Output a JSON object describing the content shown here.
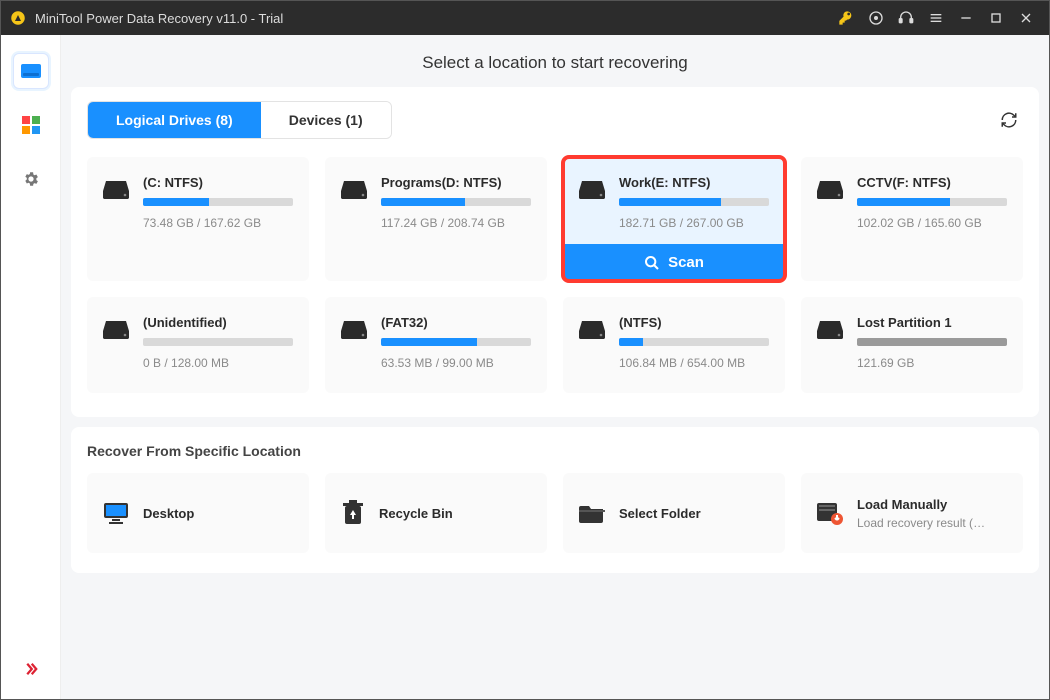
{
  "window": {
    "title": "MiniTool Power Data Recovery v11.0 - Trial"
  },
  "heading": "Select a location to start recovering",
  "tabs": {
    "logical": "Logical Drives (8)",
    "devices": "Devices (1)"
  },
  "scan_label": "Scan",
  "drives": [
    {
      "name": "(C: NTFS)",
      "usage": "73.48 GB / 167.62 GB",
      "pct": 44,
      "lost": false
    },
    {
      "name": "Programs(D: NTFS)",
      "usage": "117.24 GB / 208.74 GB",
      "pct": 56,
      "lost": false
    },
    {
      "name": "Work(E: NTFS)",
      "usage": "182.71 GB / 267.00 GB",
      "pct": 68,
      "lost": false,
      "selected": true
    },
    {
      "name": "CCTV(F: NTFS)",
      "usage": "102.02 GB / 165.60 GB",
      "pct": 62,
      "lost": false
    },
    {
      "name": "(Unidentified)",
      "usage": "0 B / 128.00 MB",
      "pct": 0,
      "lost": false
    },
    {
      "name": "(FAT32)",
      "usage": "63.53 MB / 99.00 MB",
      "pct": 64,
      "lost": false
    },
    {
      "name": "(NTFS)",
      "usage": "106.84 MB / 654.00 MB",
      "pct": 16,
      "lost": false
    },
    {
      "name": "Lost Partition 1",
      "usage": "121.69 GB",
      "pct": 100,
      "lost": true
    }
  ],
  "recover_section": "Recover From Specific Location",
  "locations": {
    "desktop": "Desktop",
    "recycle": "Recycle Bin",
    "folder": "Select Folder",
    "manual_t": "Load Manually",
    "manual_s": "Load recovery result (*..."
  }
}
